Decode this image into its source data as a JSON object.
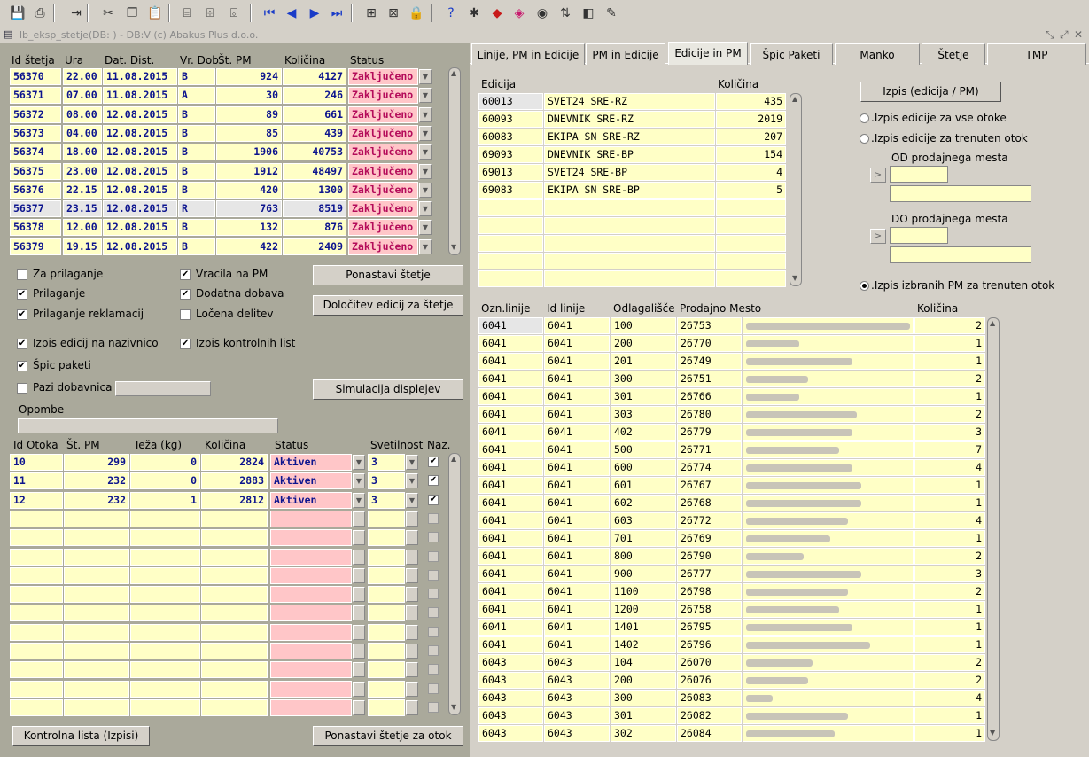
{
  "toolbar": {
    "icons": [
      "save-icon",
      "print-icon",
      "exit-icon",
      "cut-icon",
      "copy-icon",
      "paste-icon",
      "query-enter-icon",
      "query-execute-icon",
      "query-cancel-icon",
      "first-record-icon",
      "prev-record-icon",
      "next-record-icon",
      "last-record-icon",
      "insert-record-icon",
      "delete-record-icon",
      "lock-record-icon",
      "help-icon",
      "bug-icon",
      "tool-a-icon",
      "tool-b-icon",
      "tool-c-icon",
      "sort-icon",
      "tool-d-icon",
      "tool-e-icon"
    ]
  },
  "window": {
    "title": "lb_eksp_stetje(DB:     ) - DB:V (c) Abakus Plus d.o.o."
  },
  "counts": {
    "headers": [
      "Id štetja",
      "Ura",
      "Dat. Dist.",
      "Vr. Dob.",
      "Št. PM",
      "Količina",
      "Status"
    ],
    "rows": [
      [
        "56370",
        "22.00",
        "11.08.2015",
        "B",
        "924",
        "4127",
        "Zaključeno"
      ],
      [
        "56371",
        "07.00",
        "11.08.2015",
        "A",
        "30",
        "246",
        "Zaključeno"
      ],
      [
        "56372",
        "08.00",
        "12.08.2015",
        "B",
        "89",
        "661",
        "Zaključeno"
      ],
      [
        "56373",
        "04.00",
        "12.08.2015",
        "B",
        "85",
        "439",
        "Zaključeno"
      ],
      [
        "56374",
        "18.00",
        "12.08.2015",
        "B",
        "1906",
        "40753",
        "Zaključeno"
      ],
      [
        "56375",
        "23.00",
        "12.08.2015",
        "B",
        "1912",
        "48497",
        "Zaključeno"
      ],
      [
        "56376",
        "22.15",
        "12.08.2015",
        "B",
        "420",
        "1300",
        "Zaključeno"
      ],
      [
        "56377",
        "23.15",
        "12.08.2015",
        "R",
        "763",
        "8519",
        "Zaključeno"
      ],
      [
        "56378",
        "12.00",
        "12.08.2015",
        "B",
        "132",
        "876",
        "Zaključeno"
      ],
      [
        "56379",
        "19.15",
        "12.08.2015",
        "B",
        "422",
        "2409",
        "Zaključeno"
      ]
    ]
  },
  "options": {
    "za_prilaganje": "Za prilaganje",
    "prilaganje": "Prilaganje",
    "prilaganje_reklamacij": "Prilaganje reklamacij",
    "vracila_na_pm": "Vracila na PM",
    "dodatna_dobava": "Dodatna dobava",
    "locena_delitev": "Ločena delitev",
    "izpis_edicij": "Izpis edicij na nazivnico",
    "izpis_kontrolnih": "Izpis kontrolnih list",
    "spic_paketi": "Špic paketi",
    "pazi_dobavnica": "Pazi dobavnica",
    "opombe": "Opombe"
  },
  "buttons": {
    "ponastavi": "Ponastavi štetje",
    "dolocitev": "Določitev edicij za štetje",
    "simulacija": "Simulacija displejev",
    "kontrolna": "Kontrolna lista (Izpisi)",
    "ponastavi_otok": "Ponastavi štetje za otok",
    "izpis_edicija": "Izpis (edicija /  PM)"
  },
  "islands": {
    "headers": [
      "Id Otoka",
      "Št. PM",
      "Teža (kg)",
      "Količina",
      "Status",
      "Svetilnost",
      "Naz."
    ],
    "rows": [
      [
        "10",
        "299",
        "0",
        "2824",
        "Aktiven",
        "3"
      ],
      [
        "11",
        "232",
        "0",
        "2883",
        "Aktiven",
        "3"
      ],
      [
        "12",
        "232",
        "1",
        "2812",
        "Aktiven",
        "3"
      ]
    ]
  },
  "tabs": [
    "Linije, PM in Edicije",
    "PM in Edicije",
    "Edicije in PM",
    "Špic Paketi",
    "Manko",
    "Štetje",
    "TMP"
  ],
  "editions": {
    "headers": [
      "Edicija",
      "Količina"
    ],
    "rows": [
      [
        "60013",
        "SVET24 SRE-RZ",
        "435"
      ],
      [
        "60093",
        "DNEVNIK SRE-RZ",
        "2019"
      ],
      [
        "60083",
        "EKIPA SN SRE-RZ",
        "207"
      ],
      [
        "69093",
        "DNEVNIK SRE-BP",
        "154"
      ],
      [
        "69013",
        "SVET24 SRE-BP",
        "4"
      ],
      [
        "69083",
        "EKIPA SN SRE-BP",
        "5"
      ]
    ]
  },
  "print_opts": {
    "vse_otoke": ".Izpis edicije za vse otoke",
    "trenuten_otok": ".Izpis edicije za trenuten otok",
    "od": "OD prodajnega mesta",
    "do": "DO prodajnega mesta",
    "izbranih": ".Izpis izbranih PM za trenuten otok"
  },
  "pm": {
    "headers": [
      "Ozn.linije",
      "Id linije",
      "Odlagališče",
      "Prodajno Mesto",
      "Količina"
    ],
    "rows": [
      [
        "6041",
        "6041",
        "100",
        "26753",
        "2"
      ],
      [
        "6041",
        "6041",
        "200",
        "26770",
        "1"
      ],
      [
        "6041",
        "6041",
        "201",
        "26749",
        "1"
      ],
      [
        "6041",
        "6041",
        "300",
        "26751",
        "2"
      ],
      [
        "6041",
        "6041",
        "301",
        "26766",
        "1"
      ],
      [
        "6041",
        "6041",
        "303",
        "26780",
        "2"
      ],
      [
        "6041",
        "6041",
        "402",
        "26779",
        "3"
      ],
      [
        "6041",
        "6041",
        "500",
        "26771",
        "7"
      ],
      [
        "6041",
        "6041",
        "600",
        "26774",
        "4"
      ],
      [
        "6041",
        "6041",
        "601",
        "26767",
        "1"
      ],
      [
        "6041",
        "6041",
        "602",
        "26768",
        "1"
      ],
      [
        "6041",
        "6041",
        "603",
        "26772",
        "4"
      ],
      [
        "6041",
        "6041",
        "701",
        "26769",
        "1"
      ],
      [
        "6041",
        "6041",
        "800",
        "26790",
        "2"
      ],
      [
        "6041",
        "6041",
        "900",
        "26777",
        "3"
      ],
      [
        "6041",
        "6041",
        "1100",
        "26798",
        "2"
      ],
      [
        "6041",
        "6041",
        "1200",
        "26758",
        "1"
      ],
      [
        "6041",
        "6041",
        "1401",
        "26795",
        "1"
      ],
      [
        "6041",
        "6041",
        "1402",
        "26796",
        "1"
      ],
      [
        "6043",
        "6043",
        "104",
        "26070",
        "2"
      ],
      [
        "6043",
        "6043",
        "200",
        "26076",
        "2"
      ],
      [
        "6043",
        "6043",
        "300",
        "26083",
        "4"
      ],
      [
        "6043",
        "6043",
        "301",
        "26082",
        "1"
      ],
      [
        "6043",
        "6043",
        "302",
        "26084",
        "1"
      ]
    ]
  }
}
